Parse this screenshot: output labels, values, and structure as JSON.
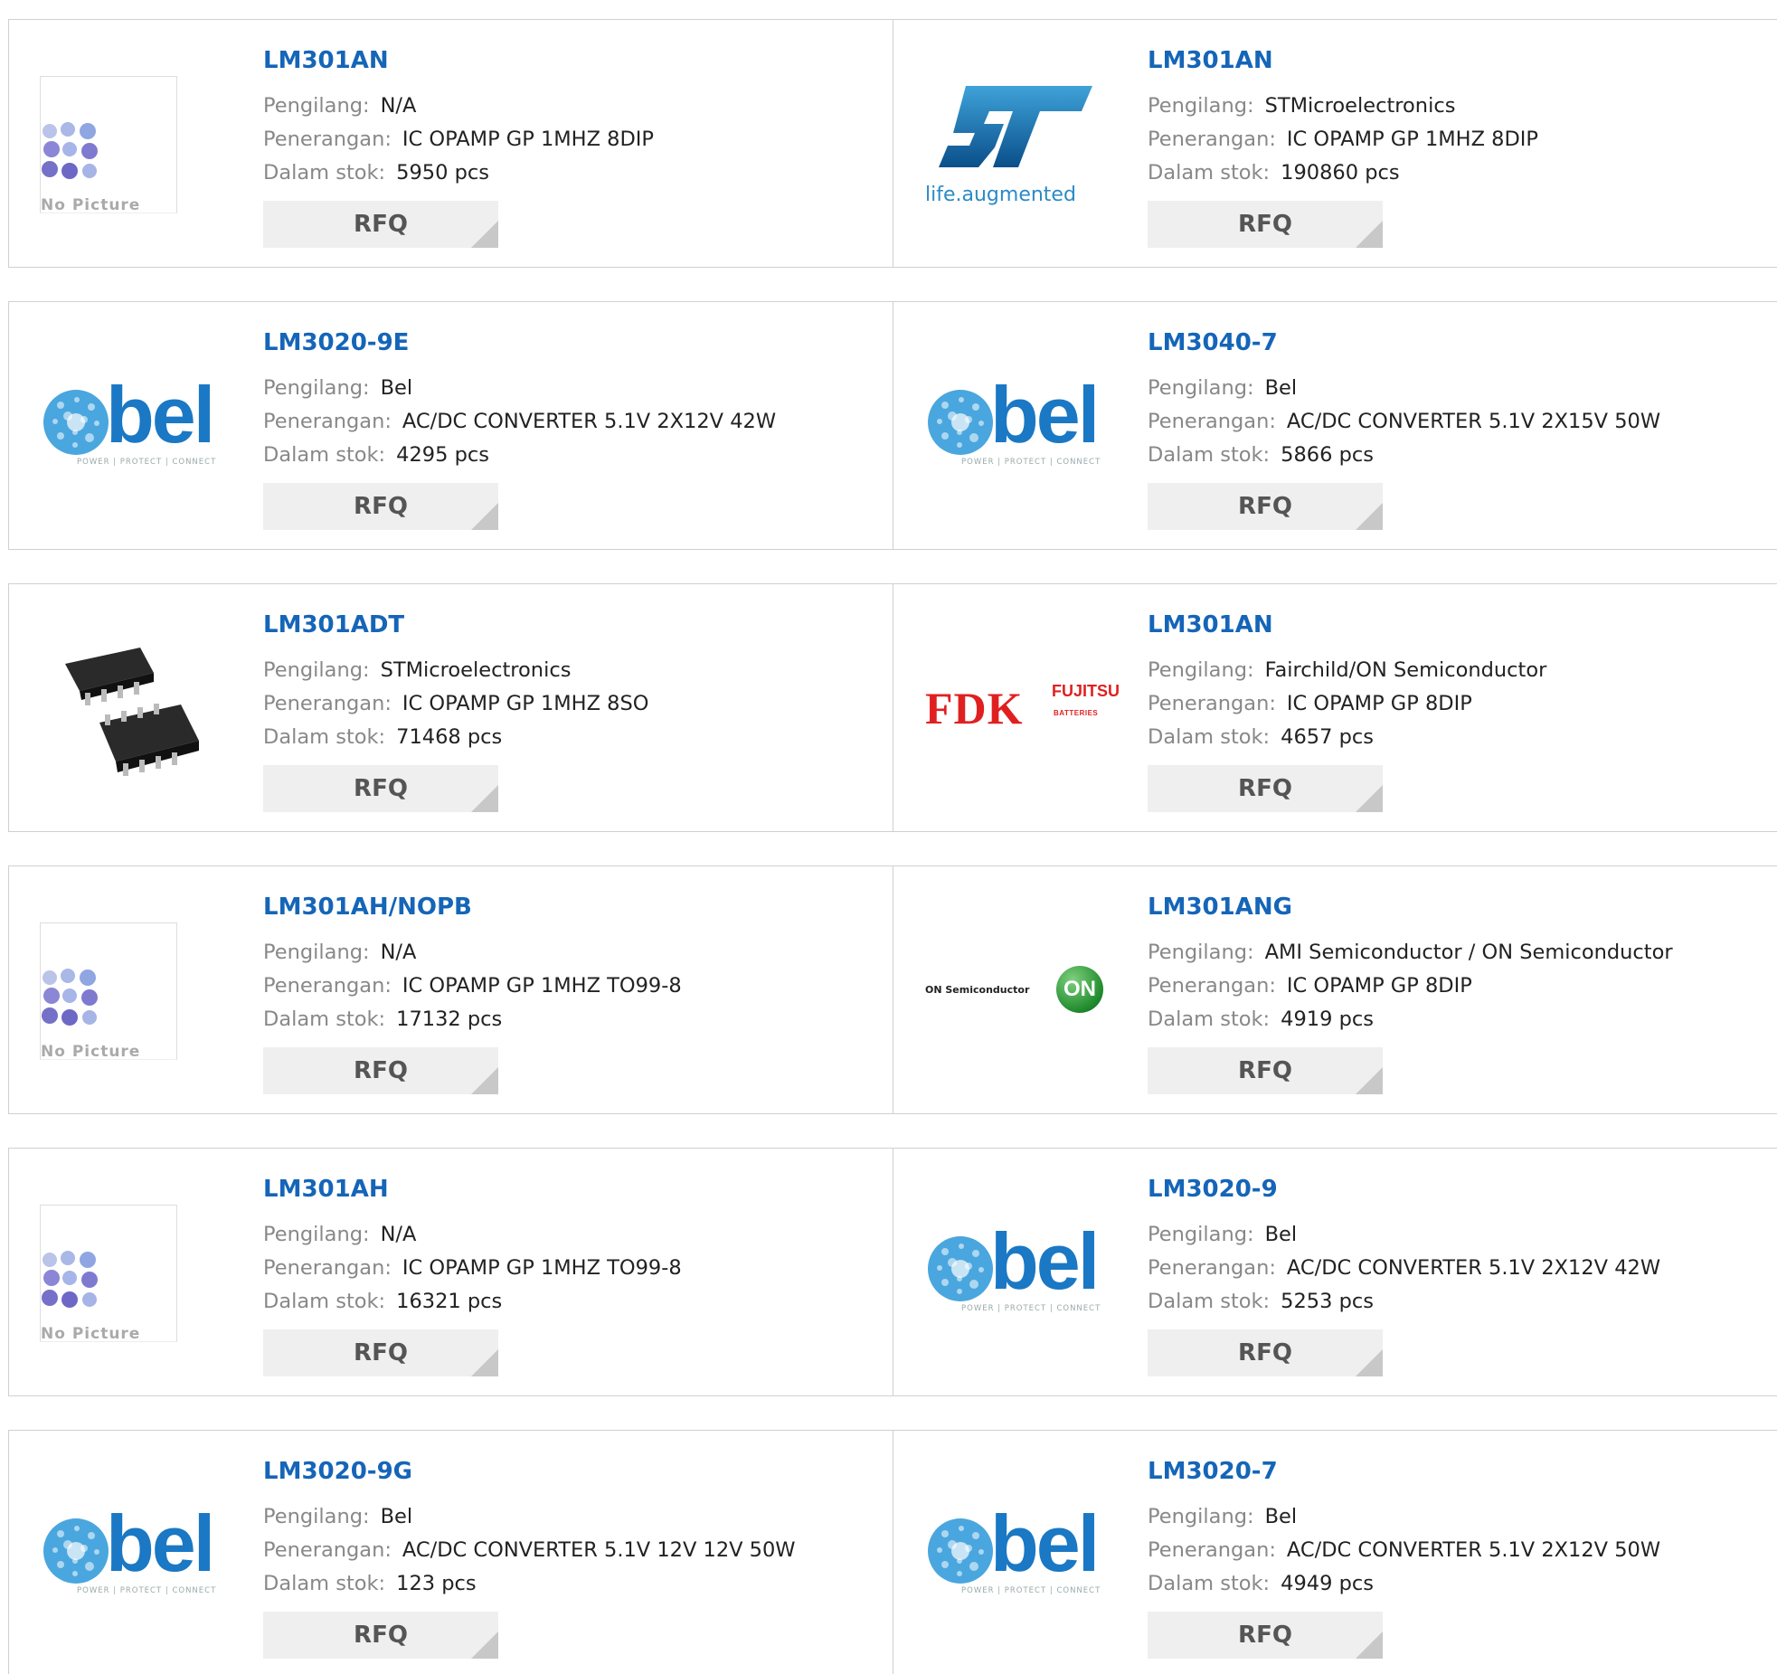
{
  "labels": {
    "manufacturer": "Pengilang:",
    "description": "Penerangan:",
    "stock": "Dalam stok:",
    "rfq": "RFQ",
    "no_picture": "No Picture"
  },
  "logo_text": {
    "bel": "bel",
    "bel_tagline": "POWER | PROTECT | CONNECT",
    "st_tagline": "life.augmented",
    "fdk": "FDK",
    "fujitsu": "FUJITSU",
    "batteries": "BATTERIES",
    "on_semi": "ON Semiconductor",
    "on": "ON"
  },
  "products": [
    {
      "part": "LM301AN",
      "manufacturer": "N/A",
      "description": "IC OPAMP GP 1MHZ 8DIP",
      "stock": "5950 pcs",
      "logo": "no-picture"
    },
    {
      "part": "LM301AN",
      "manufacturer": "STMicroelectronics",
      "description": "IC OPAMP GP 1MHZ 8DIP",
      "stock": "190860 pcs",
      "logo": "st"
    },
    {
      "part": "LM3020-9E",
      "manufacturer": "Bel",
      "description": "AC/DC CONVERTER 5.1V 2X12V 42W",
      "stock": "4295 pcs",
      "logo": "bel"
    },
    {
      "part": "LM3040-7",
      "manufacturer": "Bel",
      "description": "AC/DC CONVERTER 5.1V 2X15V 50W",
      "stock": "5866 pcs",
      "logo": "bel"
    },
    {
      "part": "LM301ADT",
      "manufacturer": "STMicroelectronics",
      "description": "IC OPAMP GP 1MHZ 8SO",
      "stock": "71468 pcs",
      "logo": "chip"
    },
    {
      "part": "LM301AN",
      "manufacturer": "Fairchild/ON Semiconductor",
      "description": "IC OPAMP GP 8DIP",
      "stock": "4657 pcs",
      "logo": "fdk"
    },
    {
      "part": "LM301AH/NOPB",
      "manufacturer": "N/A",
      "description": "IC OPAMP GP 1MHZ TO99-8",
      "stock": "17132 pcs",
      "logo": "no-picture"
    },
    {
      "part": "LM301ANG",
      "manufacturer": "AMI Semiconductor / ON Semiconductor",
      "description": "IC OPAMP GP 8DIP",
      "stock": "4919 pcs",
      "logo": "on-semi"
    },
    {
      "part": "LM301AH",
      "manufacturer": "N/A",
      "description": "IC OPAMP GP 1MHZ TO99-8",
      "stock": "16321 pcs",
      "logo": "no-picture"
    },
    {
      "part": "LM3020-9",
      "manufacturer": "Bel",
      "description": "AC/DC CONVERTER 5.1V 2X12V 42W",
      "stock": "5253 pcs",
      "logo": "bel"
    },
    {
      "part": "LM3020-9G",
      "manufacturer": "Bel",
      "description": "AC/DC CONVERTER 5.1V 12V 12V 50W",
      "stock": "123 pcs",
      "logo": "bel"
    },
    {
      "part": "LM3020-7",
      "manufacturer": "Bel",
      "description": "AC/DC CONVERTER 5.1V 2X12V 50W",
      "stock": "4949 pcs",
      "logo": "bel"
    }
  ],
  "colors": {
    "part_link": "#1565b8",
    "label": "#888888",
    "value": "#222222",
    "rfq_bg": "#efefef",
    "border": "#d0d0d0"
  }
}
